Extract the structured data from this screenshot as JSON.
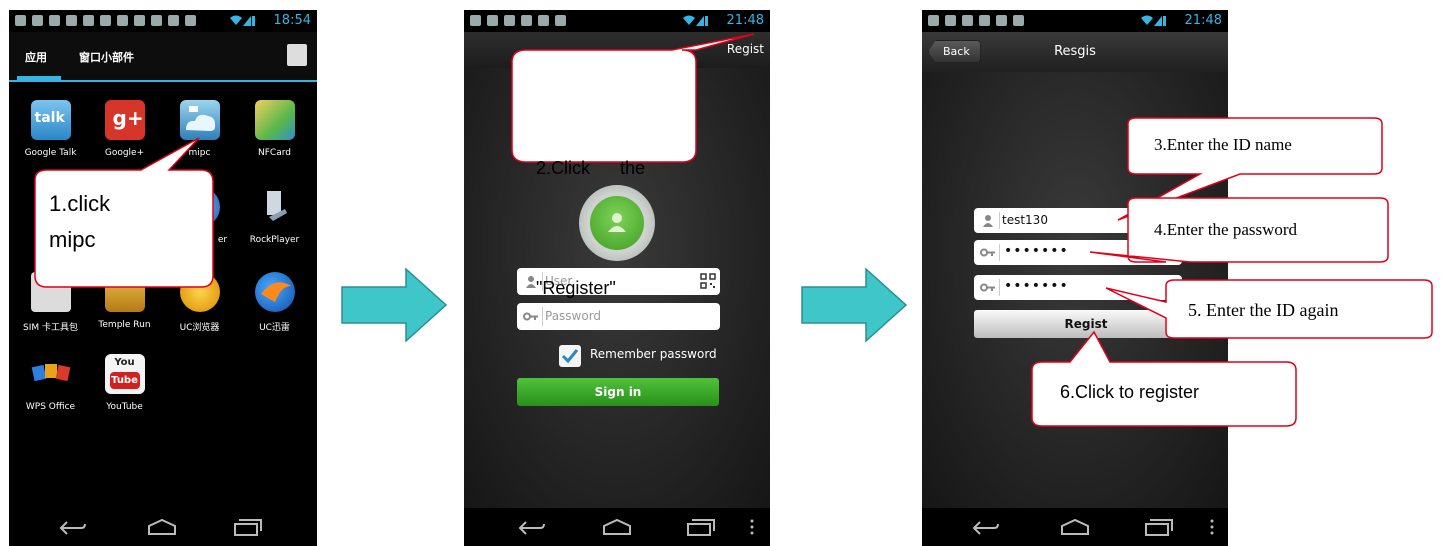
{
  "phone1": {
    "status_time": "18:54",
    "tab_apps": "应用",
    "tab_widgets": "窗口小部件",
    "apps": [
      {
        "label": "Google Talk",
        "icon": "google-talk-icon"
      },
      {
        "label": "Google+",
        "icon": "google-plus-icon"
      },
      {
        "label": "mipc",
        "icon": "mipc-icon"
      },
      {
        "label": "NFCard",
        "icon": "nfcard-icon"
      },
      {
        "label": "er",
        "icon": "player-icon"
      },
      {
        "label": "RockPlayer",
        "icon": "rockplayer-icon"
      },
      {
        "label": "SIM 卡工具包",
        "icon": "sim-toolkit-icon"
      },
      {
        "label": "Temple Run",
        "icon": "temple-run-icon"
      },
      {
        "label": "UC浏览器",
        "icon": "uc-browser-icon"
      },
      {
        "label": "UC迅雷",
        "icon": "uc-thunder-icon"
      },
      {
        "label": "WPS Office",
        "icon": "wps-office-icon"
      },
      {
        "label": "YouTube",
        "icon": "youtube-icon"
      }
    ],
    "youtube_you": "You",
    "youtube_tube": "Tube",
    "talk_text": "talk"
  },
  "phone2": {
    "status_time": "21:48",
    "regist_link": "Regist",
    "user_placeholder": "User",
    "password_placeholder": "Password",
    "remember_label": "Remember password",
    "signin_label": "Sign in"
  },
  "phone3": {
    "status_time": "21:48",
    "back_label": "Back",
    "title": "Resgis",
    "id_value": "test130",
    "password_dots": "•••••••",
    "confirm_dots": "•••••••",
    "regist_button": "Regist"
  },
  "callouts": {
    "step1_line1": "1.click",
    "step1_line2": "mipc",
    "step2_line1": "2.Click      the",
    "step2_line2": "\"Register\"",
    "step3": "3.Enter the ID name",
    "step4": "4.Enter the password",
    "step5": "5. Enter the ID again",
    "step6": "6.Click to register"
  },
  "colors": {
    "accent_blue": "#33b5e5",
    "arrow_teal": "#3ec6c9",
    "callout_border": "#e0001a",
    "signin_green": "#3aa52a"
  }
}
